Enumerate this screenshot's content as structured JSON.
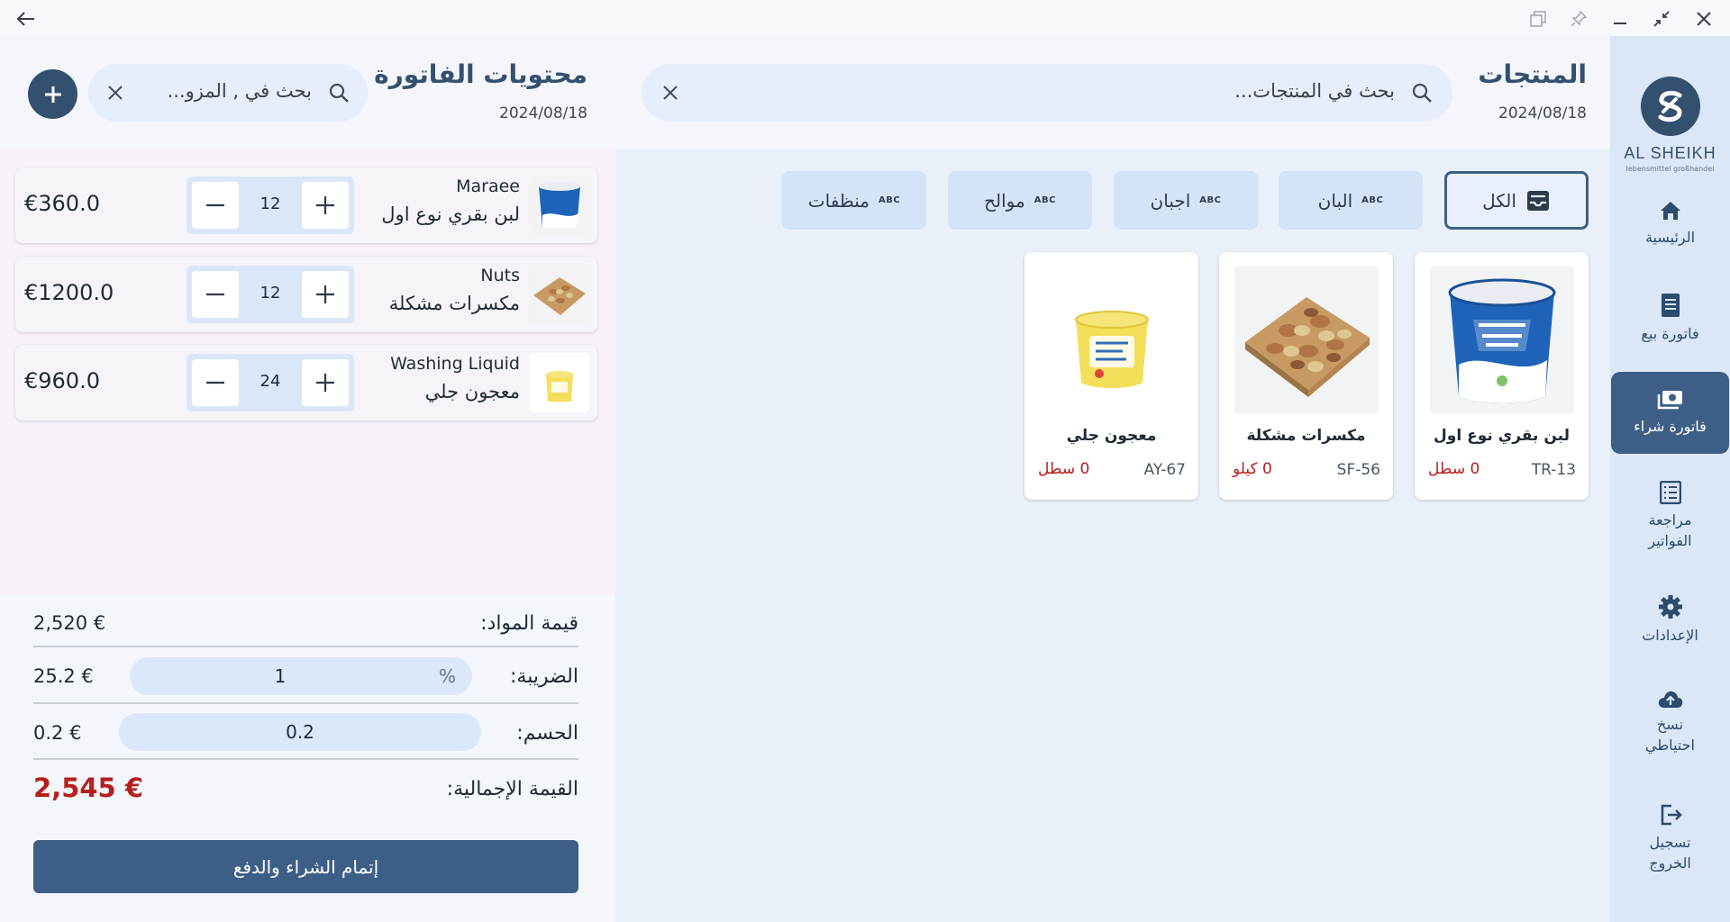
{
  "sidebar": {
    "brand": "AL SHEIKH",
    "brand_sub": "lebensmittel großhandel",
    "items": [
      {
        "label": "الرئيسية",
        "icon": "home-icon"
      },
      {
        "label": "فاتورة بيع",
        "icon": "receipt-icon"
      },
      {
        "label": "فاتورة شراء",
        "icon": "cash-icon",
        "active": true
      },
      {
        "label": "مراجعة الفواتير",
        "icon": "list-icon"
      },
      {
        "label": "الإعدادات",
        "icon": "gear-icon"
      },
      {
        "label": "نسخ احتياطي",
        "icon": "cloud-upload-icon"
      },
      {
        "label": "تسجيل الخروج",
        "icon": "logout-icon"
      }
    ]
  },
  "products": {
    "title": "المنتجات",
    "date": "2024/08/18",
    "search_placeholder": "بحث في المنتجات...",
    "categories": [
      {
        "label": "الكل",
        "active": true
      },
      {
        "label": "البان",
        "badge": "ABC"
      },
      {
        "label": "اجبان",
        "badge": "ABC"
      },
      {
        "label": "موالح",
        "badge": "ABC"
      },
      {
        "label": "منظفات",
        "badge": "ABC"
      }
    ],
    "items": [
      {
        "name": "لبن بقري نوع اول",
        "code": "TR-13",
        "stock": "0 سطل"
      },
      {
        "name": "مكسرات مشكلة",
        "code": "SF-56",
        "stock": "0 كيلو"
      },
      {
        "name": "معجون جلي",
        "code": "AY-67",
        "stock": "0 سطل"
      }
    ]
  },
  "invoice": {
    "title": "محتويات الفاتورة",
    "date": "2024/08/18",
    "search_placeholder": "بحث في , المزو...",
    "lines": [
      {
        "name_en": "Maraee",
        "name_ar": "لبن بقري نوع اول",
        "qty": "12",
        "price": "€360.0"
      },
      {
        "name_en": "Nuts",
        "name_ar": "مكسرات مشكلة",
        "qty": "12",
        "price": "€1200.0"
      },
      {
        "name_en": "Washing Liquid",
        "name_ar": "معجون جلي",
        "qty": "24",
        "price": "€960.0"
      }
    ],
    "summary": {
      "materials_label": "قيمة المواد:",
      "materials_value": "2,520 €",
      "tax_label": "الضريبة:",
      "tax_input": "1",
      "tax_unit": "%",
      "tax_value": "25.2 €",
      "discount_label": "الحسم:",
      "discount_input": "0.2",
      "discount_value": "0.2 €",
      "total_label": "القيمة الإجمالية:",
      "total_value": "2,545 €"
    },
    "checkout_label": "إتمام الشراء والدفع"
  },
  "colors": {
    "primary": "#3d5f87",
    "accent_dark": "#34506f",
    "danger": "#b81e1e",
    "chip_bg": "#d4e3f8",
    "sidebar_bg": "#dbe6f6"
  }
}
